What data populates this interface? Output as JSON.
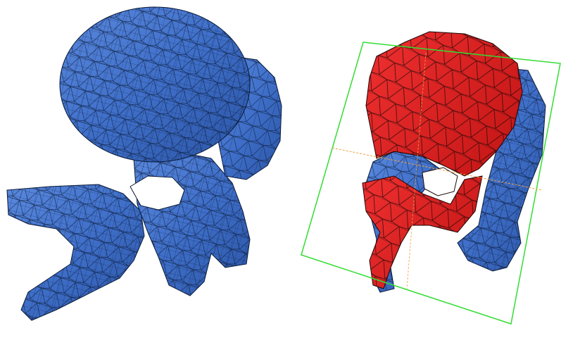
{
  "scene": {
    "background": "#ffffff",
    "panels": [
      {
        "id": "left",
        "object": "vertebra-mesh",
        "render": "wireframe-over-shaded",
        "mesh_color": "#3f6fc9",
        "edge_color": "#0a1a38"
      },
      {
        "id": "right",
        "object": "vertebra-mesh-sectioned",
        "render": "wireframe-over-shaded",
        "mesh_color": "#3f6fc9",
        "cut_color": "#e02020",
        "edge_color": "#1a0606",
        "cutting_plane": {
          "frame_color": "#33dd33",
          "axis_color": "#f0a040"
        }
      }
    ]
  }
}
